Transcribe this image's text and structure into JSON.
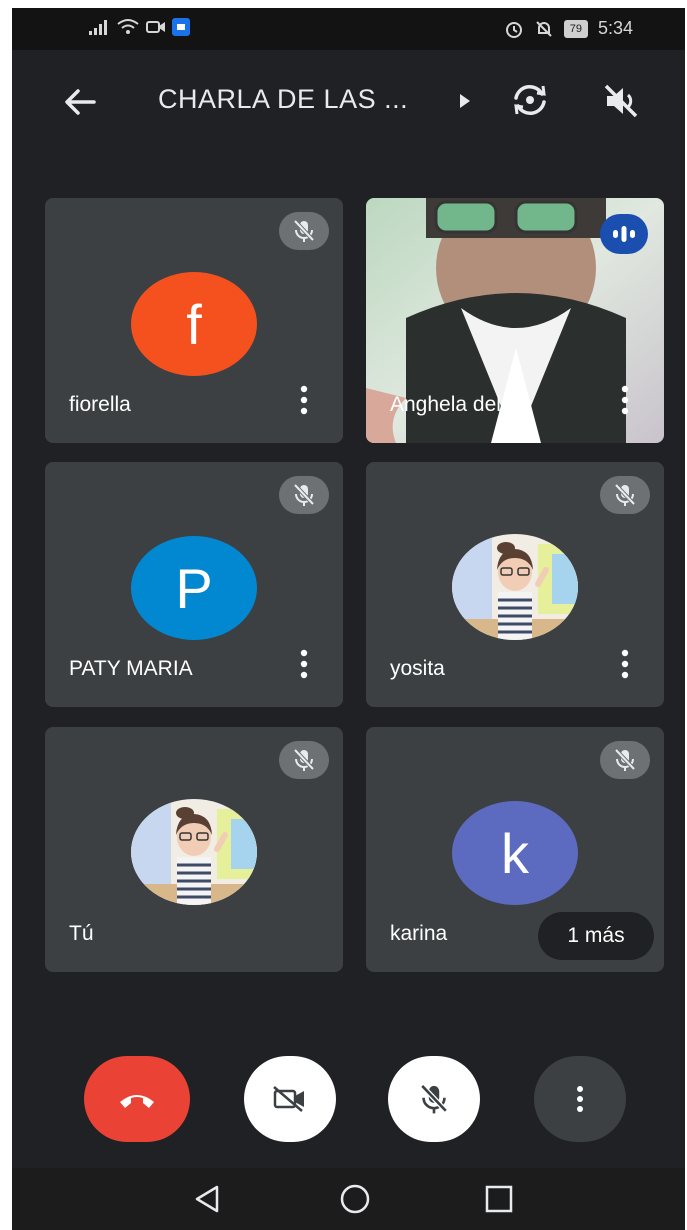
{
  "status_bar": {
    "battery": "79",
    "time": "5:34"
  },
  "header": {
    "title": "CHARLA DE LAS ..."
  },
  "participants": [
    {
      "name": "fiorella",
      "avatar_letter": "f",
      "avatar_color": "#f4511e",
      "muted": true
    },
    {
      "name": "Anghela del ...",
      "video": true,
      "speaking": true
    },
    {
      "name": "PATY MARIA",
      "avatar_letter": "P",
      "avatar_color": "#0288d1",
      "muted": true
    },
    {
      "name": "yosita",
      "avatar": "photo-avatar",
      "muted": true
    },
    {
      "name": "Tú",
      "avatar": "photo-avatar",
      "muted": true
    },
    {
      "name": "karina",
      "avatar_letter": "k",
      "avatar_color": "#5c6bc0",
      "muted": true
    }
  ],
  "more_participants": "1 más",
  "controls": {
    "end_call_color": "#ea4335",
    "camera_off": true,
    "mic_off": true
  },
  "icons": [
    "back-arrow-icon",
    "caret-right-icon",
    "switch-camera-icon",
    "speaker-off-icon",
    "mic-off-icon",
    "more-vert-icon",
    "speaking-icon",
    "end-call-icon",
    "camera-off-icon",
    "nav-back-icon",
    "nav-home-icon",
    "nav-recents-icon"
  ]
}
